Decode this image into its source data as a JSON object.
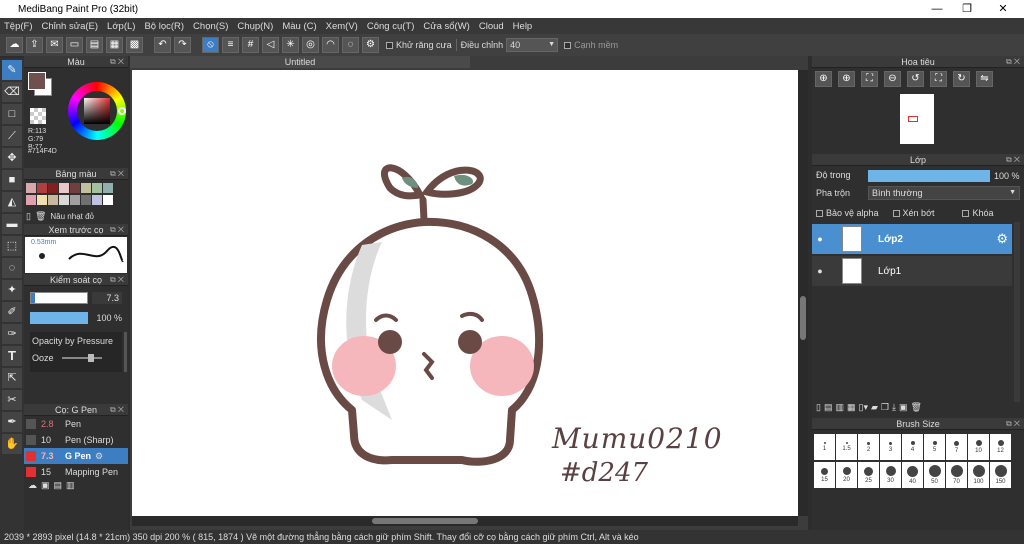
{
  "app": {
    "title": "MediBang Paint Pro (32bit)",
    "window_buttons": [
      "—",
      "❐",
      "✕"
    ]
  },
  "menu": [
    "Tệp(F)",
    "Chỉnh sửa(E)",
    "Lớp(L)",
    "Bộ lọc(R)",
    "Chọn(S)",
    "Chụp(N)",
    "Màu (C)",
    "Xem(V)",
    "Công cụ(T)",
    "Cửa sổ(W)",
    "Cloud",
    "Help"
  ],
  "toolbar": {
    "antialias_label": "Khử răng cưa",
    "correction_label": "Điều chỉnh",
    "correction_value": "40",
    "smooth_edge_label": "Cạnh mềm"
  },
  "color_panel": {
    "title": "Màu",
    "r": "R:113",
    "g": "G:79",
    "b": "B:77",
    "hex": "#714F4D",
    "color": "#714F4D"
  },
  "palette_panel": {
    "title": "Bảng màu",
    "item_label": "Nâu nhạt đỏ",
    "swatches": [
      "#d9a8a8",
      "#b04040",
      "#802020",
      "#e8c8c8",
      "#704040",
      "#c0c0a0",
      "#a0c0a0",
      "#90b0b0",
      "#e0a0b0",
      "#f0e0b0",
      "#c8b8a0",
      "#d8d8d8",
      "#a0a0a0",
      "#707070",
      "#c0c0e0",
      "#ffffff"
    ]
  },
  "preview_panel": {
    "title": "Xem trước cọ",
    "size": "0.53mm"
  },
  "brush_control": {
    "title": "Kiểm soát cọ",
    "size_value": "7.3",
    "opacity_value": "100 %",
    "opacity_pressure_label": "Opacity by Pressure",
    "ooze_label": "Ooze"
  },
  "brush_list": {
    "title": "Cọ: G Pen",
    "items": [
      {
        "size": "2.8",
        "name": "Pen",
        "color": "#555555"
      },
      {
        "size": "10",
        "name": "Pen (Sharp)",
        "color": "#555555"
      },
      {
        "size": "7.3",
        "name": "G Pen",
        "color": "#e03030"
      },
      {
        "size": "15",
        "name": "Mapping Pen",
        "color": "#e03030"
      }
    ]
  },
  "document": {
    "tab": "Untitled",
    "signature_line1": "Mumu0210",
    "signature_line2": "#d247"
  },
  "navigator": {
    "title": "Hoa tiêu"
  },
  "layers": {
    "title": "Lớp",
    "opacity_label": "Độ trong",
    "opacity_value": "100 %",
    "blend_label": "Pha trộn",
    "blend_value": "Bình thường",
    "protect_alpha": "Bảo vệ alpha",
    "clipping": "Xén bớt",
    "lock": "Khóa",
    "items": [
      "Lớp2",
      "Lớp1"
    ]
  },
  "brush_size": {
    "title": "Brush Size",
    "row1": [
      "1",
      "1.5",
      "2",
      "3",
      "4",
      "5",
      "7",
      "10",
      "12"
    ],
    "row2": [
      "15",
      "20",
      "25",
      "30",
      "40",
      "50",
      "70",
      "100",
      "150"
    ]
  },
  "status": {
    "text": "2039 * 2893 pixel   (14.8 * 21cm)   350 dpi   200 %   ( 815, 1874 )   Vẽ một đường thẳng bằng cách giữ phím Shift. Thay đổi cỡ cọ bằng cách giữ phím Ctrl, Alt và kéo"
  }
}
